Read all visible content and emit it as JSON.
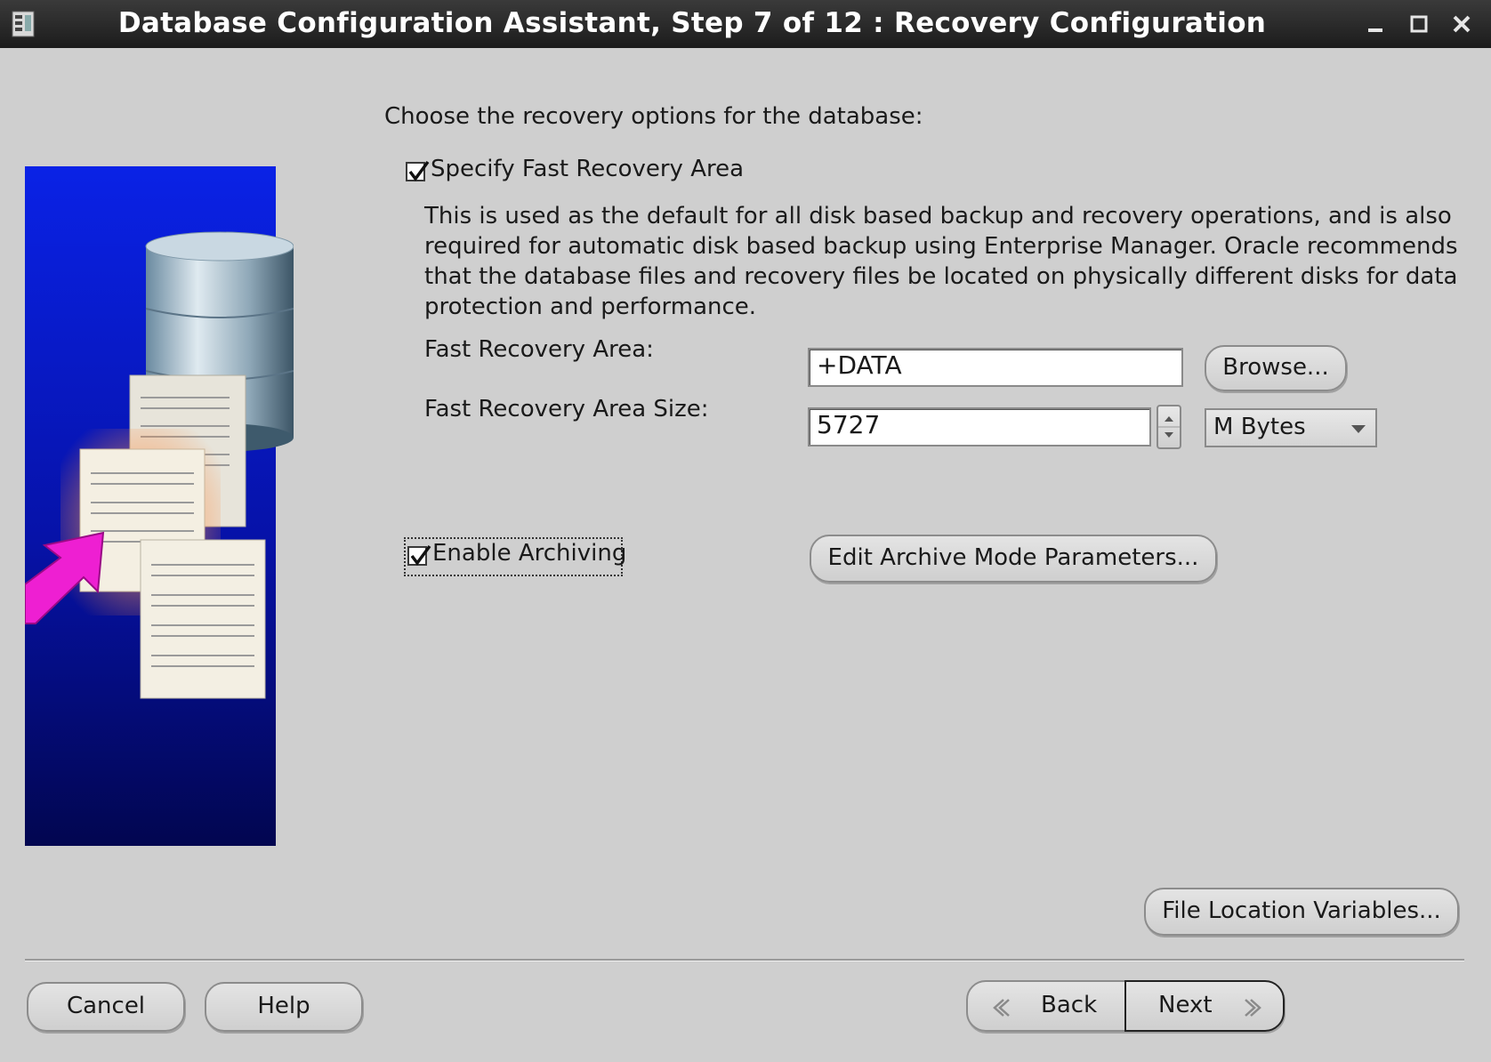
{
  "window": {
    "title": "Database Configuration Assistant, Step 7 of 12 : Recovery Configuration",
    "minimize_label": "_",
    "maximize_label": "□",
    "close_label": "✕"
  },
  "intro": "Choose the recovery options for the database:",
  "fast_recovery": {
    "checkbox_label": "Specify Fast Recovery Area",
    "checked": true,
    "description": "This is used as the default for all disk based backup and recovery operations, and is also required for automatic disk based backup using Enterprise Manager. Oracle recommends that the database files and recovery files be located on physically different disks for data protection and performance.",
    "area_label": "Fast Recovery Area:",
    "area_value": "+DATA",
    "browse_label": "Browse...",
    "size_label": "Fast Recovery Area Size:",
    "size_value": "5727",
    "unit_value": "M Bytes"
  },
  "archiving": {
    "checkbox_label": "Enable Archiving",
    "checked": true,
    "edit_params_label": "Edit Archive Mode Parameters..."
  },
  "file_location_label": "File Location Variables...",
  "footer": {
    "cancel_label": "Cancel",
    "help_label": "Help",
    "back_label": "Back",
    "next_label": "Next"
  },
  "colors": {
    "window_bg": "#cfcfcf",
    "titlebar_bg": "#1c1c1c",
    "illustration_bg": "#0a1fd6"
  },
  "icons": [
    "app-icon",
    "minimize-icon",
    "maximize-icon",
    "close-icon",
    "checkmark-icon",
    "spinner-up-icon",
    "spinner-down-icon",
    "dropdown-arrow-icon",
    "back-chevron-icon",
    "next-chevron-icon"
  ]
}
